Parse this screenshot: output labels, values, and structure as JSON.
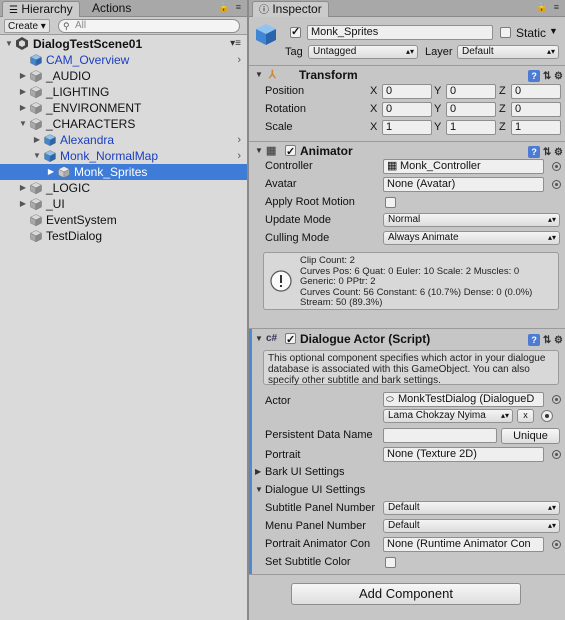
{
  "hierarchy": {
    "tab_label": "Hierarchy",
    "actions_tab_label": "Actions",
    "create_label": "Create ▾",
    "search_placeholder": "All",
    "scene_name": "DialogTestScene01",
    "items": [
      {
        "label": "CAM_Overview",
        "blue": true,
        "arrow": "",
        "chevron": true
      },
      {
        "label": "_AUDIO",
        "arrow": "▶"
      },
      {
        "label": "_LIGHTING",
        "arrow": "▶"
      },
      {
        "label": "_ENVIRONMENT",
        "arrow": "▶"
      },
      {
        "label": "_CHARACTERS",
        "arrow": "▼"
      },
      {
        "label": "Alexandra",
        "blue": true,
        "arrow": "▶",
        "chevron": true
      },
      {
        "label": "Monk_NormalMap",
        "blue": true,
        "arrow": "▼",
        "chevron": true
      },
      {
        "label": "Monk_Sprites",
        "selected": true,
        "arrow": "▶"
      },
      {
        "label": "_LOGIC",
        "arrow": "▶"
      },
      {
        "label": "_UI",
        "arrow": "▶"
      },
      {
        "label": "EventSystem",
        "arrow": ""
      },
      {
        "label": "TestDialog",
        "arrow": ""
      }
    ]
  },
  "inspector": {
    "tab_label": "Inspector",
    "object_name": "Monk_Sprites",
    "static_label": "Static",
    "tag_label": "Tag",
    "tag_value": "Untagged",
    "layer_label": "Layer",
    "layer_value": "Default",
    "transform": {
      "title": "Transform",
      "rows": [
        {
          "label": "Position",
          "x": "0",
          "y": "0",
          "z": "0"
        },
        {
          "label": "Rotation",
          "x": "0",
          "y": "0",
          "z": "0"
        },
        {
          "label": "Scale",
          "x": "1",
          "y": "1",
          "z": "1"
        }
      ],
      "axis_x": "X",
      "axis_y": "Y",
      "axis_z": "Z"
    },
    "animator": {
      "title": "Animator",
      "controller_label": "Controller",
      "controller_value": "Monk_Controller",
      "avatar_label": "Avatar",
      "avatar_value": "None (Avatar)",
      "root_motion_label": "Apply Root Motion",
      "update_mode_label": "Update Mode",
      "update_mode_value": "Normal",
      "culling_mode_label": "Culling Mode",
      "culling_mode_value": "Always Animate",
      "info_lines": [
        "Clip Count: 2",
        "Curves Pos: 6 Quat: 0 Euler: 10 Scale: 2 Muscles: 0",
        "Generic: 0 PPtr: 2",
        "Curves Count: 56 Constant: 6 (10.7%) Dense: 0 (0.0%)",
        "Stream: 50 (89.3%)"
      ]
    },
    "dialogue_actor": {
      "title": "Dialogue Actor (Script)",
      "description": "This optional component specifies which actor in your dialogue database is associated with this GameObject. You can also specify other subtitle and bark settings.",
      "actor_label": "Actor",
      "actor_db_value": "MonkTestDialog (DialogueD",
      "actor_name_value": "Lama Chokzay Nyima",
      "persistent_label": "Persistent Data Name",
      "persistent_value": "",
      "unique_label": "Unique",
      "portrait_label": "Portrait",
      "portrait_value": "None (Texture 2D)",
      "bark_ui_label": "Bark UI Settings",
      "dialogue_ui_label": "Dialogue UI Settings",
      "subtitle_panel_label": "Subtitle Panel Number",
      "subtitle_panel_value": "Default",
      "menu_panel_label": "Menu Panel Number",
      "menu_panel_value": "Default",
      "portrait_anim_label": "Portrait Animator Con",
      "portrait_anim_value": "None (Runtime Animator Con",
      "subtitle_color_label": "Set Subtitle Color"
    },
    "add_component_label": "Add Component"
  }
}
